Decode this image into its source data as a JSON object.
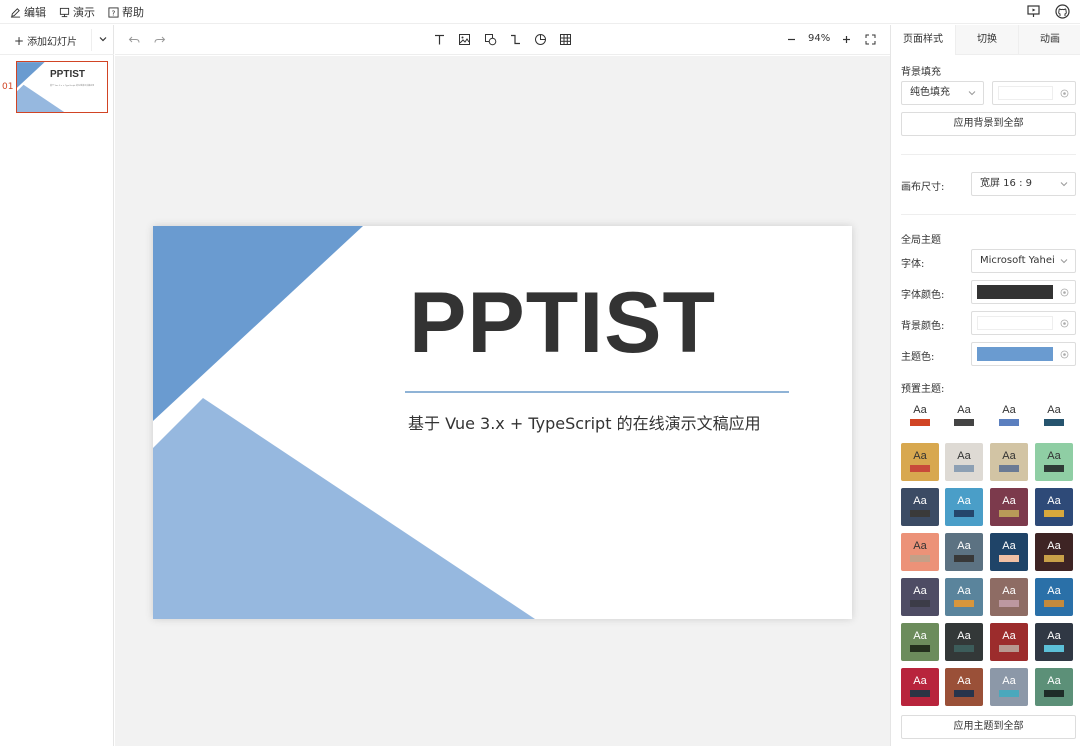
{
  "menu": {
    "edit": "编辑",
    "present": "演示",
    "help": "帮助"
  },
  "left": {
    "add_slide": "添加幻灯片",
    "slide_number": "01",
    "thumb_title": "PPTIST",
    "thumb_sub": "基于 Vue 3.x + TypeScript 的在线演示文稿应用"
  },
  "toolbar": {
    "zoom": "94%"
  },
  "slide": {
    "title": "PPTIST",
    "subtitle": "基于 Vue 3.x + TypeScript 的在线演示文稿应用"
  },
  "panel": {
    "tabs": [
      "页面样式",
      "切换",
      "动画"
    ],
    "bg_fill_label": "背景填充",
    "bg_fill_type": "纯色填充",
    "apply_bg_all": "应用背景到全部",
    "canvas_size_label": "画布尺寸:",
    "canvas_size_value": "宽屏 16 : 9",
    "global_theme": "全局主题",
    "font_label": "字体:",
    "font_value": "Microsoft Yahei",
    "font_color_label": "字体颜色:",
    "bg_color_label": "背景颜色:",
    "theme_color_label": "主题色:",
    "preset_theme_label": "预置主题:",
    "apply_theme_all": "应用主题到全部",
    "font_color": "#333333",
    "bg_color": "#ffffff",
    "theme_color": "#6a9bd0",
    "aa": "Aa"
  },
  "presets": [
    {
      "bg": "#ffffff",
      "fg": "#333333",
      "accent": "#d14424"
    },
    {
      "bg": "#ffffff",
      "fg": "#333333",
      "accent": "#444444"
    },
    {
      "bg": "#ffffff",
      "fg": "#333333",
      "accent": "#5b7fbf"
    },
    {
      "bg": "#ffffff",
      "fg": "#333333",
      "accent": "#26546e"
    },
    {
      "bg": "#d8a84f",
      "fg": "#333333",
      "accent": "#c84a3a"
    },
    {
      "bg": "#dedad4",
      "fg": "#333333",
      "accent": "#8da0b4"
    },
    {
      "bg": "#d2c4a4",
      "fg": "#333333",
      "accent": "#6a7a94"
    },
    {
      "bg": "#8fcea4",
      "fg": "#333333",
      "accent": "#2e3b36"
    },
    {
      "bg": "#3b4b64",
      "fg": "#ffffff",
      "accent": "#3a3a3a"
    },
    {
      "bg": "#4a9ec8",
      "fg": "#ffffff",
      "accent": "#25466c"
    },
    {
      "bg": "#7c3a4c",
      "fg": "#ffffff",
      "accent": "#b89a58"
    },
    {
      "bg": "#2e4a78",
      "fg": "#ffffff",
      "accent": "#d8a83c"
    },
    {
      "bg": "#ec9278",
      "fg": "#333333",
      "accent": "#c4a088"
    },
    {
      "bg": "#5c7282",
      "fg": "#ffffff",
      "accent": "#383838"
    },
    {
      "bg": "#1f4468",
      "fg": "#ffffff",
      "accent": "#f0c0a4"
    },
    {
      "bg": "#3e2424",
      "fg": "#ffffff",
      "accent": "#c8a048"
    },
    {
      "bg": "#4e4c64",
      "fg": "#ffffff",
      "accent": "#3c3c48"
    },
    {
      "bg": "#5a849c",
      "fg": "#ffffff",
      "accent": "#d8963c"
    },
    {
      "bg": "#8e6c64",
      "fg": "#ffffff",
      "accent": "#bc98a0"
    },
    {
      "bg": "#2a70a8",
      "fg": "#ffffff",
      "accent": "#c48a3c"
    },
    {
      "bg": "#6c8c5c",
      "fg": "#ffffff",
      "accent": "#24301e"
    },
    {
      "bg": "#333838",
      "fg": "#ffffff",
      "accent": "#3c5c5a"
    },
    {
      "bg": "#9c2c2c",
      "fg": "#ffffff",
      "accent": "#b89890"
    },
    {
      "bg": "#303844",
      "fg": "#ffffff",
      "accent": "#5cc0d8"
    },
    {
      "bg": "#b8243c",
      "fg": "#ffffff",
      "accent": "#2c3444"
    },
    {
      "bg": "#9a5038",
      "fg": "#ffffff",
      "accent": "#28344c"
    },
    {
      "bg": "#8c98a8",
      "fg": "#ffffff",
      "accent": "#4aa8bc"
    },
    {
      "bg": "#5c9078",
      "fg": "#ffffff",
      "accent": "#1e2c28"
    }
  ]
}
